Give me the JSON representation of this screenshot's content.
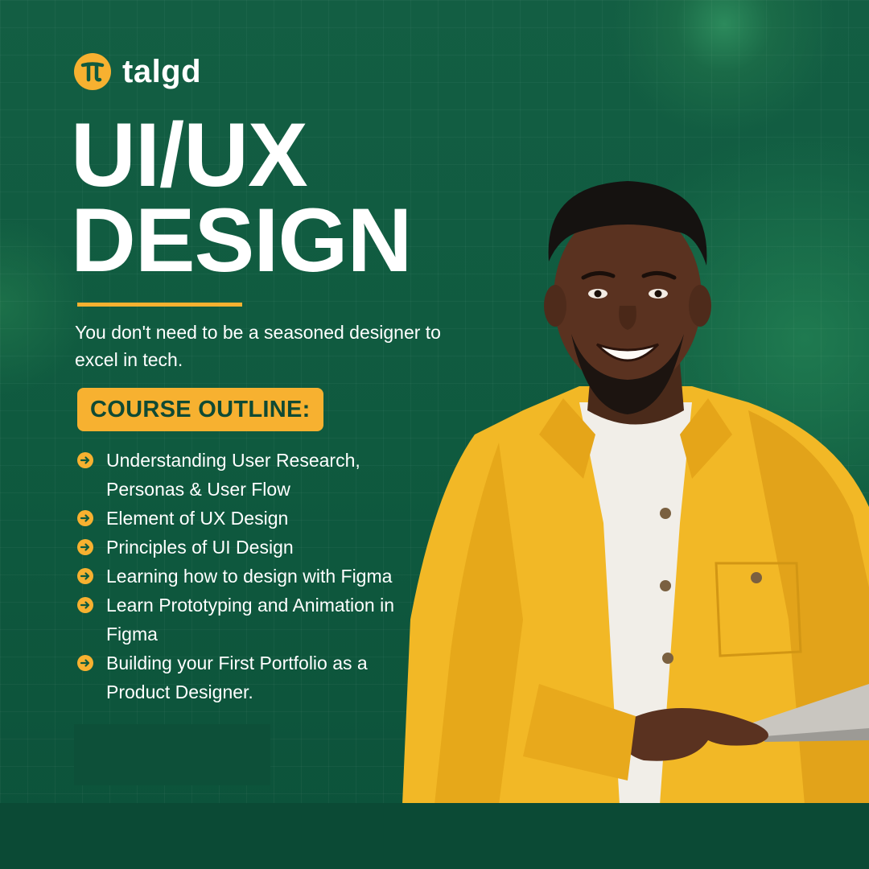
{
  "brand": {
    "name": "talgd",
    "logo_icon": "pi-logo-icon",
    "accent": "#f7b130",
    "background": "#0f5a3f"
  },
  "headline": {
    "line1": "UI/UX",
    "line2": "DESIGN"
  },
  "tagline": "You don't need to be a seasoned designer to excel in tech.",
  "course": {
    "badge": "COURSE OUTLINE:",
    "items": [
      "Understanding User Research, Personas & User Flow",
      "Element of UX Design",
      "Principles of UI Design",
      "Learning how to design with Figma",
      "Learn Prototyping and Animation in Figma",
      "Building your First Portfolio as a Product Designer."
    ],
    "bullet_icon": "arrow-circle-right-icon"
  }
}
